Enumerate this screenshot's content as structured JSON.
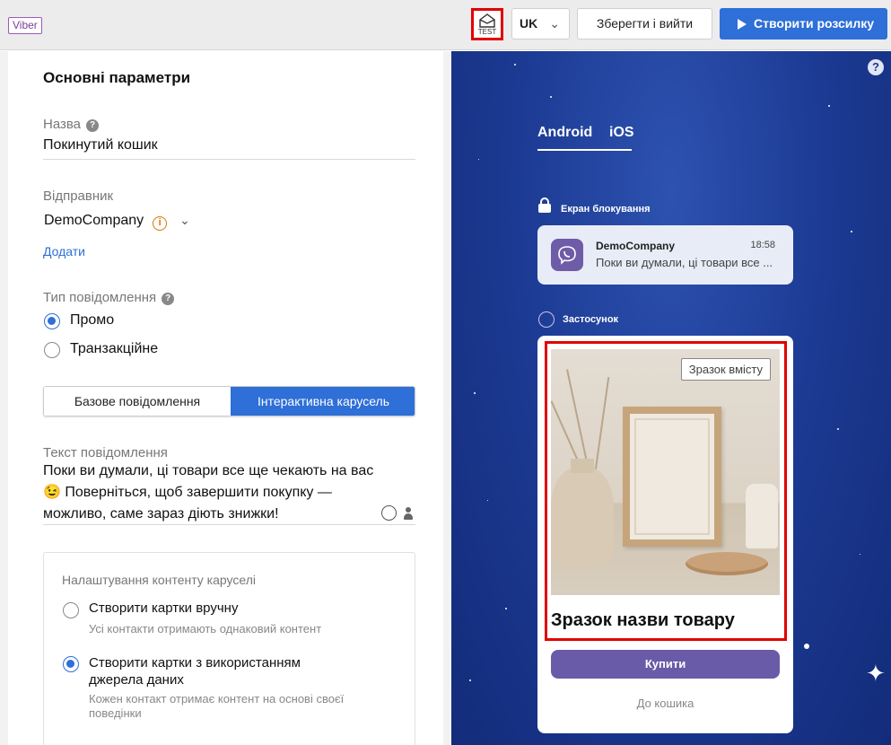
{
  "topbar": {
    "channel_badge": "Viber",
    "test_label": "TEST",
    "language": "UK",
    "save_label": "Зберегти і вийти",
    "create_label": "Створити розсилку"
  },
  "form": {
    "section_title": "Основні параметри",
    "name_label": "Назва",
    "name_value": "Покинутий кошик",
    "sender_label": "Відправник",
    "sender_value": "DemoCompany",
    "add_link": "Додати",
    "msg_type_label": "Тип повідомлення",
    "type_options": [
      {
        "label": "Промо",
        "selected": true
      },
      {
        "label": "Транзакційне",
        "selected": false
      }
    ],
    "segments": [
      "Базове повідомлення",
      "Інтерактивна карусель"
    ],
    "active_segment": 1,
    "text_label": "Текст повідомлення",
    "text_value": "Поки ви думали, ці товари все ще чекають на вас 😉 Поверніться, щоб завершити покупку — можливо, саме зараз діють знижки!",
    "carousel": {
      "title": "Налаштування контенту каруселі",
      "options": [
        {
          "label": "Створити картки вручну",
          "sub": "Усі контакти отримають однаковий контент",
          "selected": false
        },
        {
          "label": "Створити картки з використанням джерела даних",
          "sub": "Кожен контакт отримає контент на основі своєї поведінки",
          "selected": true
        }
      ]
    }
  },
  "preview": {
    "help": "?",
    "tabs": [
      "Android",
      "iOS"
    ],
    "lock_screen_label": "Екран блокування",
    "notification": {
      "sender": "DemoCompany",
      "time": "18:58",
      "text": "Поки ви думали, ці товари все ..."
    },
    "app_label": "Застосунок",
    "card": {
      "tag": "Зразок вмісту",
      "title": "Зразок назви товару",
      "buy": "Купити",
      "cart": "До кошика"
    }
  },
  "colors": {
    "accent": "#2e6fd8",
    "viber_purple": "#6e5ca8",
    "highlight": "#e00000",
    "preview_bg": "#1c3a93"
  }
}
